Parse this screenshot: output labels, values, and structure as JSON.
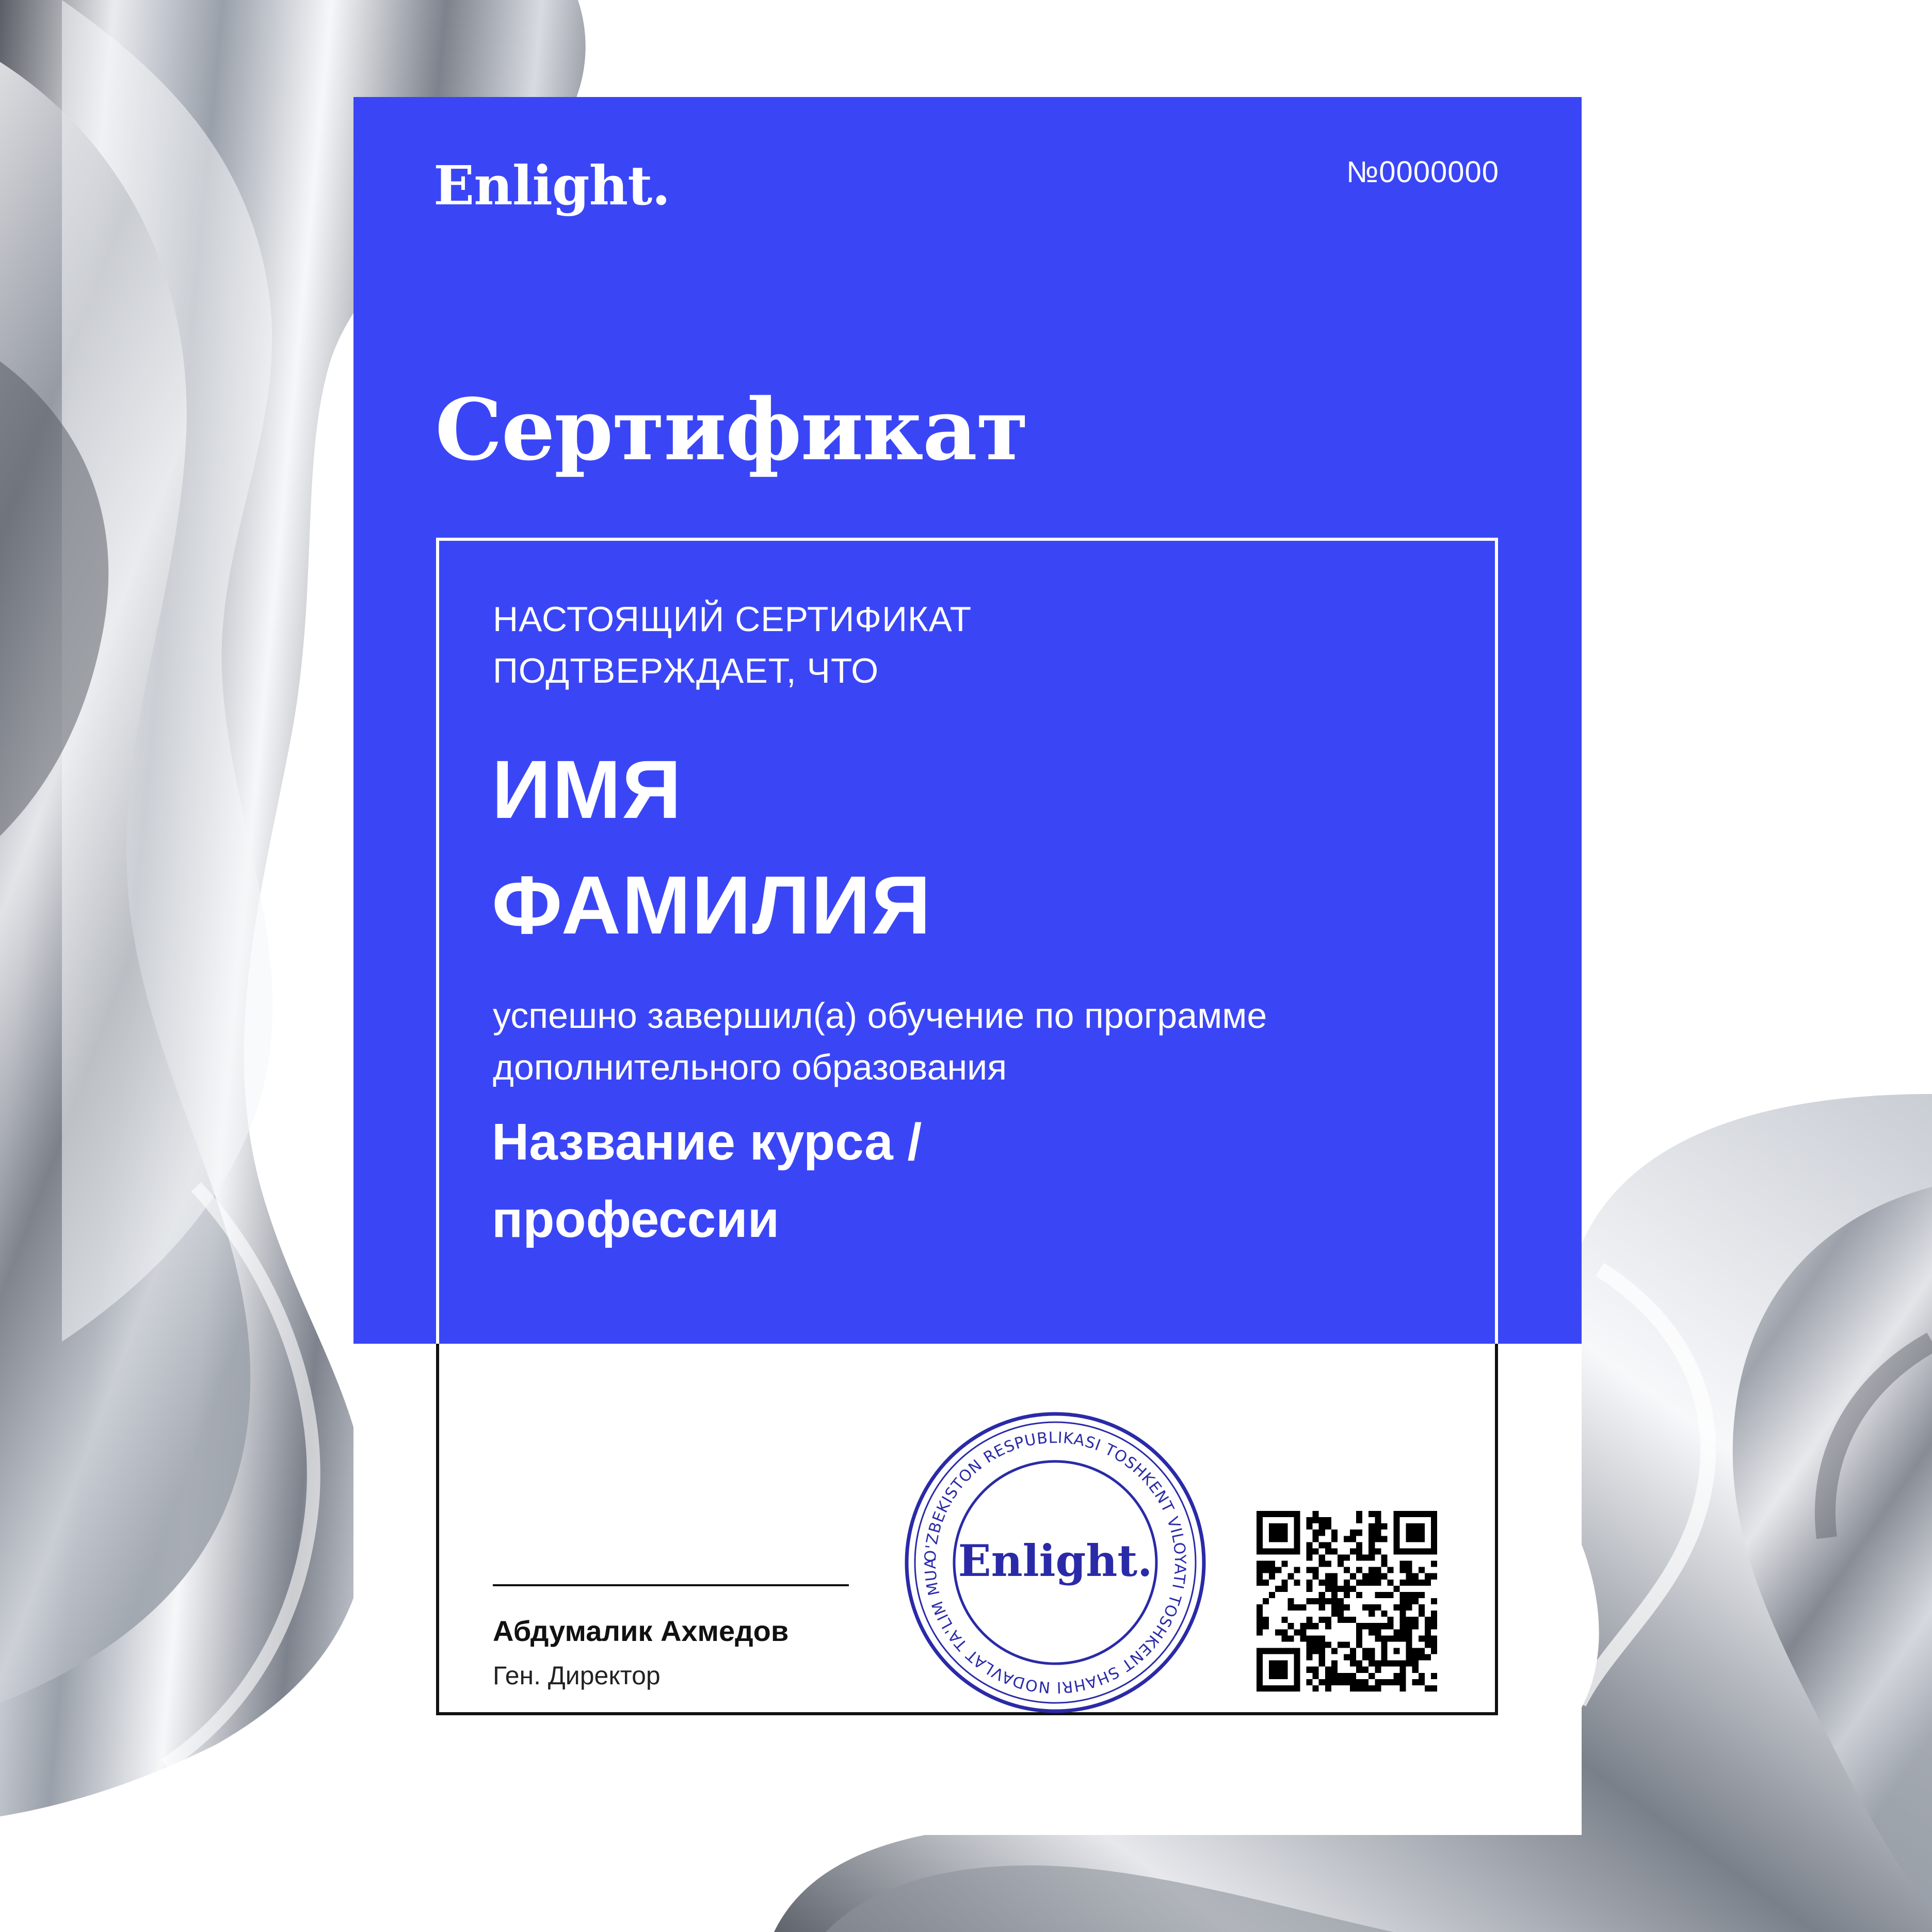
{
  "certificate": {
    "brand": "Enlight.",
    "number": "№0000000",
    "title": "Сертификат",
    "intro_lines": [
      "НАСТОЯЩИЙ СЕРТИФИКАТ",
      "ПОДТВЕРЖДАЕТ, ЧТО"
    ],
    "name_lines": [
      "ИМЯ",
      "ФАМИЛИЯ"
    ],
    "completion_lines": [
      "успешно завершил(а) обучение по программе",
      "дополнительного образования"
    ],
    "course_lines": [
      "Название курса /",
      "профессии"
    ],
    "signer_name": "Абдумалик Ахмедов",
    "signer_role": "Ген. Директор"
  },
  "stamp": {
    "center_text": "Enlight.",
    "ring_text": "O'ZBEKISTON RESPUBLIKASI TOSHKENT VILOYATI TOSHKENT SHAHRI NODAVLAT TA'LIM MUASSASI *",
    "color": "#2A2AA8"
  },
  "colors": {
    "accent": "#3A46F5",
    "paper": "#FFFFFF",
    "ink": "#111111"
  }
}
